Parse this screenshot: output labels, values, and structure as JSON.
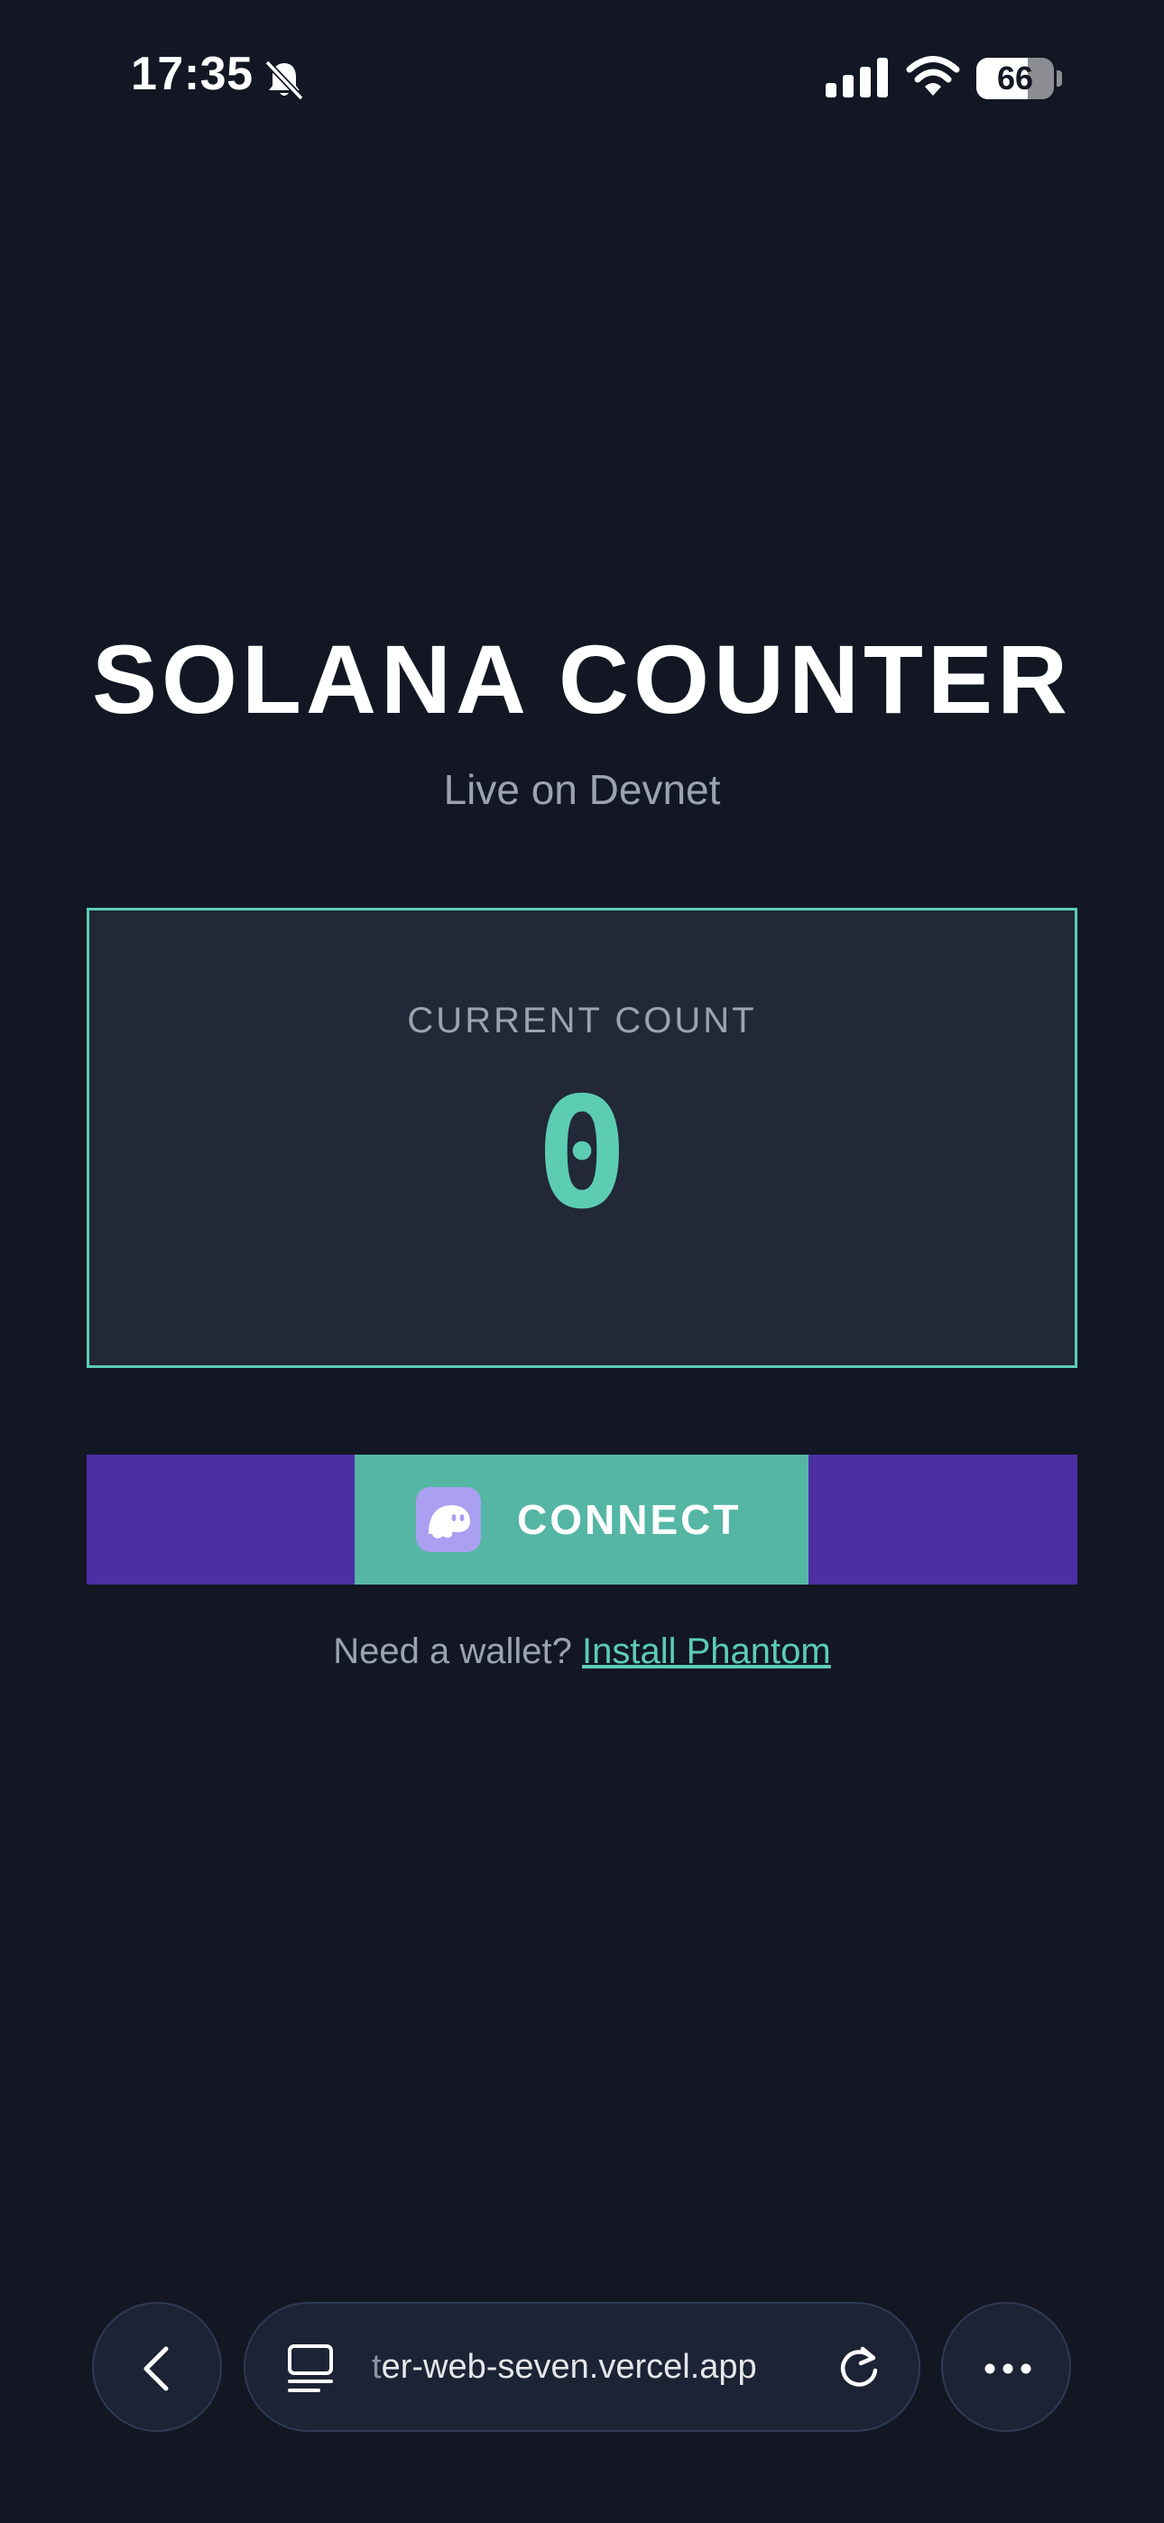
{
  "status_bar": {
    "time": "17:35",
    "battery_percent": 66,
    "battery_text": "66",
    "icons": [
      "bell-slash-icon",
      "cellular-signal-icon",
      "wifi-icon",
      "battery-icon"
    ]
  },
  "app": {
    "title": "SOLANA COUNTER",
    "subtitle": "Live on Devnet",
    "count_label": "CURRENT COUNT",
    "count_value": "0",
    "connect_label": "CONNECT",
    "wallet_prompt": "Need a wallet?",
    "install_link": "Install Phantom"
  },
  "browser": {
    "url_faded": "t",
    "url_visible": "er-web-seven.vercel.app",
    "icons": [
      "back-icon",
      "tabs-icon",
      "reload-icon",
      "more-icon"
    ]
  },
  "colors": {
    "background": "#121723",
    "card": "#222838",
    "accent_teal": "#5ccdb3",
    "button_teal": "#55b6a4",
    "purple": "#4b2fa3",
    "phantom": "#ab9ff2"
  }
}
